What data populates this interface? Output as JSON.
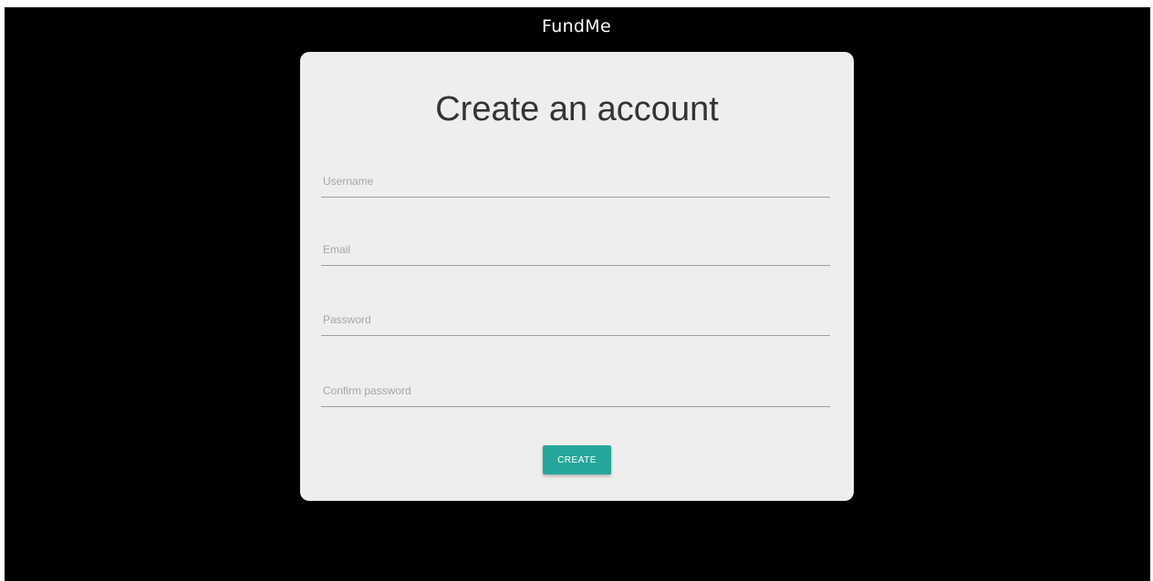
{
  "app": {
    "brand": "FundMe"
  },
  "signup": {
    "title": "Create an account",
    "fields": {
      "username": {
        "placeholder": "Username",
        "value": ""
      },
      "email": {
        "placeholder": "Email",
        "value": ""
      },
      "password": {
        "placeholder": "Password",
        "value": ""
      },
      "confirm_password": {
        "placeholder": "Confirm password",
        "value": ""
      }
    },
    "submit_label": "CREATE"
  },
  "colors": {
    "background": "#000000",
    "card": "#eeeeee",
    "accent": "#26a69a"
  }
}
